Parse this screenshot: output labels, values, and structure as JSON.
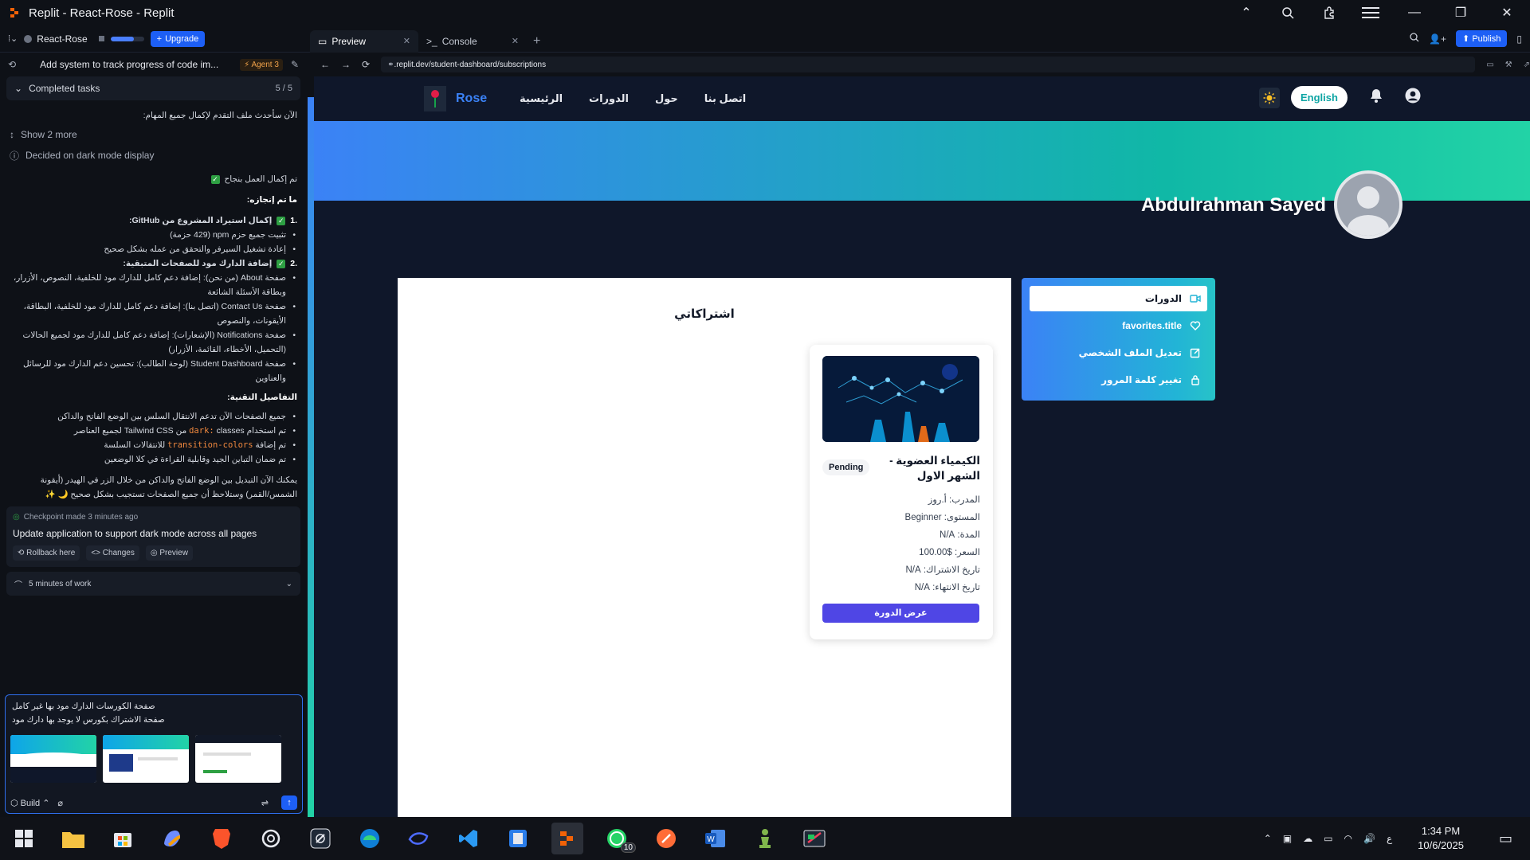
{
  "window": {
    "title": "Replit - React-Rose - Replit"
  },
  "replit": {
    "project_name": "React-Rose",
    "storage_progress": 0.7,
    "upgrade_label": "Upgrade",
    "tabs": [
      {
        "label": "Preview"
      },
      {
        "label": "Console"
      }
    ],
    "publish_label": "Publish"
  },
  "agent": {
    "task_title": "Add system to track progress of code im...",
    "badge": "Agent 3",
    "completed_label": "Completed tasks",
    "completed_count": "5 / 5",
    "msg_intro": "الآن سأحدث ملف التقدم لإكمال جميع المهام:",
    "show_more": "Show 2 more",
    "decided": "Decided on dark mode display",
    "done_line": "تم إكمال العمل بنجاح",
    "achieved_header": "ما تم إنجازه:",
    "item1_title": "إكمال استيراد المشروع من GitHub:",
    "item1_b1": "تثبيت جميع حزم npm (429 حزمة)",
    "item1_b2": "إعادة تشغيل السيرفر والتحقق من عمله بشكل صحيح",
    "item2_title": "إضافة الدارك مود للصفحات المتبقية:",
    "item2_b1": "صفحة About (من نحن): إضافة دعم كامل للدارك مود للخلفية، النصوص، الأزرار، وبطاقة الأسئلة الشائعة",
    "item2_b2": "صفحة Contact Us (اتصل بنا): إضافة دعم كامل للدارك مود للخلفية، البطاقة، الأيقونات، والنصوص",
    "item2_b3": "صفحة Notifications (الإشعارات): إضافة دعم كامل للدارك مود لجميع الحالات (التحميل، الأخطاء، القائمة، الأزرار)",
    "item2_b4": "صفحة Student Dashboard (لوحة الطالب): تحسين دعم الدارك مود للرسائل والعناوين",
    "tech_header": "التفاصيل التقنية:",
    "tech_b1": "جميع الصفحات الآن تدعم الانتقال السلس بين الوضع الفاتح والداكن",
    "tech_b2_pre": "تم استخدام",
    "tech_b2_code": "dark:",
    "tech_b2_post": "classes من Tailwind CSS لجميع العناصر",
    "tech_b3_pre": "تم إضافة",
    "tech_b3_code": "transition-colors",
    "tech_b3_post": "للانتقالات السلسة",
    "tech_b4": "تم ضمان التباين الجيد وقابلية القراءة في كلا الوضعين",
    "closing": "يمكنك الآن التبديل بين الوضع الفاتح والداكن من خلال الزر في الهيدر (أيقونة الشمس/القمر) وستلاحظ أن جميع الصفحات تستجيب بشكل صحيح 🌙 ✨",
    "checkpoint_meta": "Checkpoint made 3 minutes ago",
    "checkpoint_title": "Update application to support dark mode across all pages",
    "rollback": "Rollback here",
    "changes": "Changes",
    "preview": "Preview",
    "work_time": "5 minutes of work",
    "input_line1": "صفحة الكورسات الدارك مود بها غير كامل",
    "input_line2": "صفحة الاشتراك بكورس لا يوجد بها دارك مود",
    "build_label": "Build"
  },
  "preview_url": {
    "domain": ".replit.dev",
    "path": "/student-dashboard/subscriptions"
  },
  "site": {
    "brand": "Rose",
    "nav": [
      "الرئيسية",
      "الدورات",
      "حول",
      "اتصل بنا"
    ],
    "lang_button": "English",
    "user_name": "Abdulrahman Sayed",
    "panel_title": "اشتراكاتي",
    "course": {
      "title": "الكيمياء العضوية - الشهر الاول",
      "status": "Pending",
      "meta": [
        "المدرب: أ.روز",
        "المستوى: Beginner",
        "المدة: N/A",
        "السعر: $100.00",
        "تاريخ الاشتراك: N/A",
        "تاريخ الانتهاء: N/A"
      ],
      "button": "عرض الدورة"
    },
    "side_menu": [
      {
        "label": "الدورات",
        "icon": "video-icon"
      },
      {
        "label": "favorites.title",
        "icon": "heart-icon"
      },
      {
        "label": "تعديل الملف الشخصي",
        "icon": "edit-icon"
      },
      {
        "label": "تغيير كلمة المرور",
        "icon": "lock-icon"
      }
    ]
  },
  "taskbar": {
    "whatsapp_badge": "10",
    "lang_indicator": "ع",
    "time": "1:34 PM",
    "date": "10/6/2025"
  },
  "colors": {
    "accent": "#1d5ff5",
    "brand": "#3b82f6",
    "teal": "#22d3a6",
    "button": "#4f46e5"
  }
}
